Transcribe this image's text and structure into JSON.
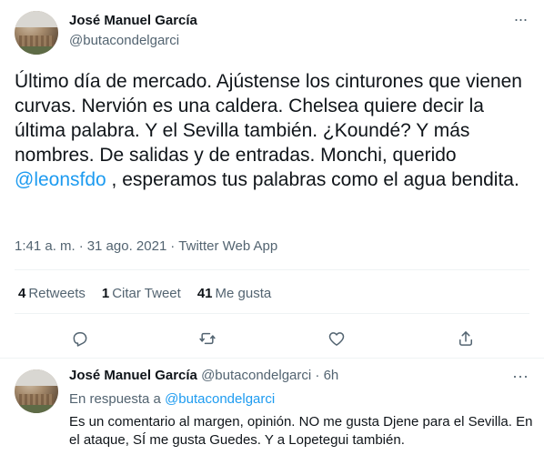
{
  "tweet": {
    "author_name": "José Manuel García",
    "author_handle": "@butacondelgarci",
    "text_lines_before_mention": "Último día de mercado. Ajústense los cinturones que vienen curvas.  Nervión es una caldera. Chelsea quiere decir la última palabra. Y el Sevilla también. ¿Koundé? Y más nombres. De salidas y de entradas. Monchi, querido ",
    "mention": "@leonsfdo",
    "text_after_mention": " , esperamos tus palabras como el agua bendita.",
    "time": "1:41 a. m.",
    "date": "31 ago. 2021",
    "source": "Twitter Web App",
    "stats": {
      "retweets_count": "4",
      "retweets_label": "Retweets",
      "quotes_count": "1",
      "quotes_label": "Citar Tweet",
      "likes_count": "41",
      "likes_label": "Me gusta"
    },
    "more_glyph": "···"
  },
  "reply": {
    "author_name": "José Manuel García",
    "author_handle": "@butacondelgarci",
    "time_ago": "6h",
    "replying_prefix": "En respuesta a",
    "replying_to": "@butacondelgarci",
    "text": "Es un comentario al margen, opinión. NO me gusta Djene para el Sevilla. En el ataque, SÍ me gusta Guedes. Y a Lopetegui también.",
    "more_glyph": "···"
  },
  "icons": {
    "reply": "reply-icon",
    "retweet": "retweet-icon",
    "like": "heart-icon",
    "share": "share-icon"
  },
  "colors": {
    "accent": "#1d9bf0",
    "secondary_text": "#536471",
    "divider": "#eff3f4"
  }
}
